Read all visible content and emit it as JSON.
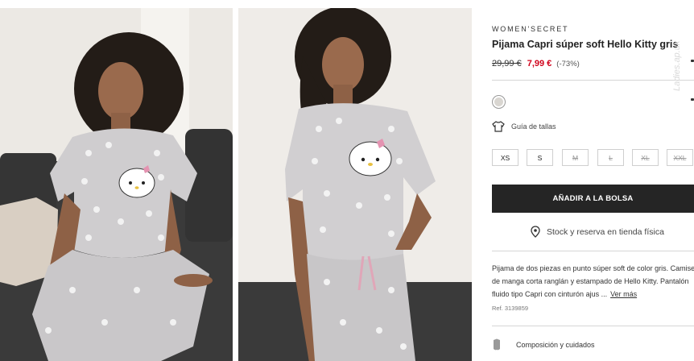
{
  "product": {
    "brand": "WOMEN'SECRET",
    "title": "Pijama Capri súper soft Hello Kitty gris",
    "old_price": "29,99 €",
    "new_price": "7,99 €",
    "discount": "(-73%)",
    "selected_color": "#d9d6d1",
    "ref": "Ref. 3139859"
  },
  "size_guide": {
    "label": "Guía de tallas",
    "icon": "tshirt-icon"
  },
  "sizes": [
    {
      "label": "XS",
      "available": true
    },
    {
      "label": "S",
      "available": true
    },
    {
      "label": "M",
      "available": false
    },
    {
      "label": "L",
      "available": false
    },
    {
      "label": "XL",
      "available": false
    },
    {
      "label": "XXL",
      "available": false
    }
  ],
  "actions": {
    "add_to_bag": "AÑADIR A LA BOLSA",
    "stock": "Stock y reserva en tienda física",
    "see_more": "Ver más"
  },
  "description": {
    "lines": [
      "Pijama de dos piezas en punto súper soft de color gris. Camiseta",
      "de manga corta ranglán y estampado de Hello Kitty. Pantalón",
      "fluido tipo Capri con cinturón ajus ..."
    ]
  },
  "composition": {
    "label": "Composición y cuidados",
    "icon": "fabric-tag-icon"
  },
  "watermark": "Ladies.ap.uk",
  "colors": {
    "accent_red": "#d0021b",
    "button_dark": "#252525"
  }
}
